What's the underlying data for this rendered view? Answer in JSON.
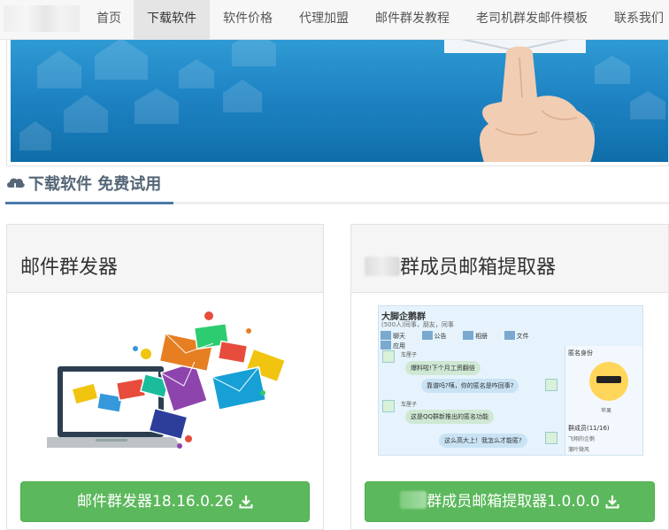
{
  "nav": {
    "items": [
      {
        "label": "首页",
        "active": false
      },
      {
        "label": "下载软件",
        "active": true
      },
      {
        "label": "软件价格",
        "active": false
      },
      {
        "label": "代理加盟",
        "active": false
      },
      {
        "label": "邮件群发教程",
        "active": false
      },
      {
        "label": "老司机群发邮件模板",
        "active": false
      },
      {
        "label": "联系我们",
        "active": false
      }
    ]
  },
  "section": {
    "title": "下载软件 免费试用",
    "icon": "cloud-download-icon"
  },
  "cards": [
    {
      "title": "邮件群发器",
      "button_label": "邮件群发器18.16.0.26",
      "button_icon": "download-icon",
      "image": "laptop-with-envelopes-illustration"
    },
    {
      "title": "群成员邮箱提取器",
      "button_label": "群成员邮箱提取器1.0.0.0",
      "button_icon": "download-icon",
      "image": "qq-group-chat-screenshot"
    }
  ],
  "qq_window": {
    "group_name": "大脚企鹅群",
    "group_sub": "(500人)同事，朋友，同事",
    "toolbar": [
      "聊天",
      "公告",
      "相册",
      "文件",
      "应用"
    ],
    "messages": [
      {
        "sender": "车厘子",
        "text": "爆料啦!下个月工资翻倍",
        "side": "left"
      },
      {
        "text": "靠谱吗?咦，你的匿名是咋回事?",
        "side": "right"
      },
      {
        "sender": "车厘子",
        "text": "这是QQ群新推出的匿名功能",
        "side": "left"
      },
      {
        "text": "这么高大上！我怎么才能匿?",
        "side": "right"
      }
    ],
    "sidebar": {
      "heading": "匿名身份",
      "anon_name": "苹果",
      "members_label": "群成员(11/16)",
      "members": [
        "飞翔的企鹅",
        "蒲叶微风"
      ]
    }
  },
  "colors": {
    "nav_bg": "#f7f7f7",
    "nav_active_bg": "#e5e5e5",
    "banner_blue": "#1f84c4",
    "section_accent": "#4a79a8",
    "button_green": "#5cb85c"
  }
}
